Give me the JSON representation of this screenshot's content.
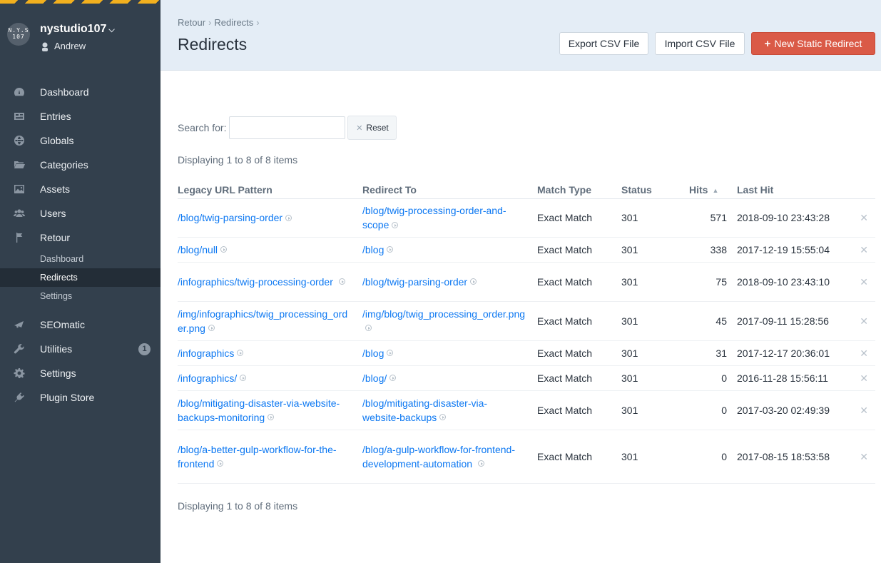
{
  "sidebar": {
    "site_logo_text": "N.Y.S\n107",
    "site_name": "nystudio107",
    "user_name": "Andrew",
    "nav": [
      {
        "label": "Dashboard",
        "icon": "dashboard-icon"
      },
      {
        "label": "Entries",
        "icon": "entries-icon"
      },
      {
        "label": "Globals",
        "icon": "globe-icon"
      },
      {
        "label": "Categories",
        "icon": "folder-icon"
      },
      {
        "label": "Assets",
        "icon": "image-icon"
      },
      {
        "label": "Users",
        "icon": "users-icon"
      },
      {
        "label": "Retour",
        "icon": "flag-icon"
      }
    ],
    "retour_sub": [
      {
        "label": "Dashboard",
        "active": false
      },
      {
        "label": "Redirects",
        "active": true
      },
      {
        "label": "Settings",
        "active": false
      }
    ],
    "nav2": [
      {
        "label": "SEOmatic",
        "icon": "seomatic-icon"
      },
      {
        "label": "Utilities",
        "icon": "wrench-icon",
        "badge": "1"
      },
      {
        "label": "Settings",
        "icon": "gear-icon"
      },
      {
        "label": "Plugin Store",
        "icon": "plug-icon"
      }
    ]
  },
  "header": {
    "breadcrumbs": [
      "Retour",
      "Redirects"
    ],
    "title": "Redirects",
    "export_label": "Export CSV File",
    "import_label": "Import CSV File",
    "new_label": "New Static Redirect",
    "accent_color": "#da5a47"
  },
  "search": {
    "label": "Search for:",
    "value": "",
    "reset_label": "Reset"
  },
  "displaying_text": "Displaying 1 to 8 of 8 items",
  "table": {
    "columns": [
      "Legacy URL Pattern",
      "Redirect To",
      "Match Type",
      "Status",
      "Hits",
      "Last Hit"
    ],
    "rows": [
      {
        "legacy": "/blog/twig-parsing-order",
        "to": "/blog/twig-processing-order-and-scope",
        "match": "Exact Match",
        "status": "301",
        "hits": "571",
        "last": "2018-09-10 23:43:28"
      },
      {
        "legacy": "/blog/null",
        "to": "/blog",
        "match": "Exact Match",
        "status": "301",
        "hits": "338",
        "last": "2017-12-19 15:55:04"
      },
      {
        "legacy": "/infographics/twig-processing-order",
        "to": "/blog/twig-parsing-order",
        "match": "Exact Match",
        "status": "301",
        "hits": "75",
        "last": "2018-09-10 23:43:10"
      },
      {
        "legacy": "/img/infographics/twig_processing_order.png",
        "to": "/img/blog/twig_processing_order.png",
        "match": "Exact Match",
        "status": "301",
        "hits": "45",
        "last": "2017-09-11 15:28:56"
      },
      {
        "legacy": "/infographics",
        "to": "/blog",
        "match": "Exact Match",
        "status": "301",
        "hits": "31",
        "last": "2017-12-17 20:36:01"
      },
      {
        "legacy": "/infographics/",
        "to": "/blog/",
        "match": "Exact Match",
        "status": "301",
        "hits": "0",
        "last": "2016-11-28 15:56:11"
      },
      {
        "legacy": "/blog/mitigating-disaster-via-website-backups-monitoring",
        "to": "/blog/mitigating-disaster-via-website-backups",
        "match": "Exact Match",
        "status": "301",
        "hits": "0",
        "last": "2017-03-20 02:49:39"
      },
      {
        "legacy": "/blog/a-better-gulp-workflow-for-the-frontend",
        "to": "/blog/a-gulp-workflow-for-frontend-development-automation",
        "match": "Exact Match",
        "status": "301",
        "hits": "0",
        "last": "2017-08-15 18:53:58"
      }
    ]
  }
}
